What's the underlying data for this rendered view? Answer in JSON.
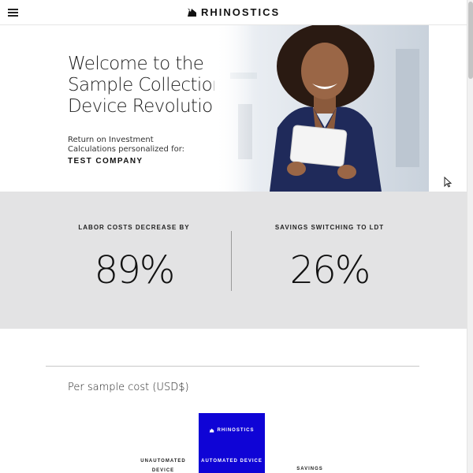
{
  "header": {
    "brand": "RHINOSTICS",
    "icons": {
      "menu": "hamburger-menu-icon",
      "logo": "rhino-logo-icon"
    }
  },
  "hero": {
    "title": "Welcome to the Sample Collection Device Revolution",
    "subtitle": "Return on Investment Calculations personalized for:",
    "company": "TEST COMPANY"
  },
  "stats": [
    {
      "label": "LABOR COSTS DECREASE BY",
      "value": "89%"
    },
    {
      "label": "SAVINGS SWITCHING TO LDT",
      "value": "26%"
    }
  ],
  "cost_section": {
    "title": "Per sample cost (USD$)",
    "columns": [
      {
        "label": "UNAUTOMATED DEVICE"
      },
      {
        "label": "AUTOMATED DEVICE",
        "brand": "RHINOSTICS"
      },
      {
        "label": "SAVINGS"
      }
    ]
  },
  "colors": {
    "accent": "#0f04d6",
    "stats_background": "#e3e3e4",
    "text": "#111111"
  }
}
